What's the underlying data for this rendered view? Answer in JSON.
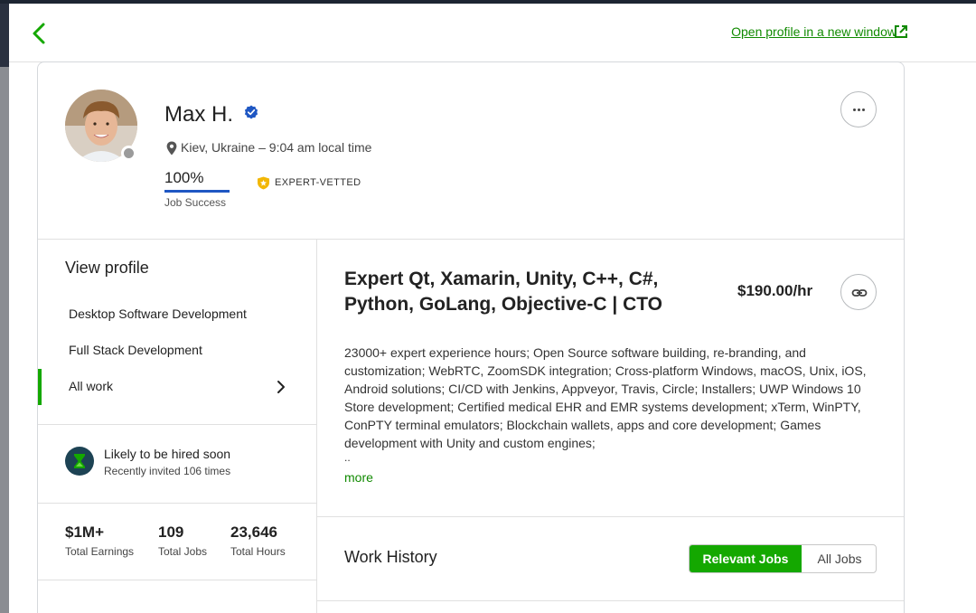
{
  "header": {
    "open_profile_link": "Open profile in a new window"
  },
  "profile": {
    "name": "Max H.",
    "location": "Kiev, Ukraine – 9:04 am local time",
    "job_success_value": "100%",
    "job_success_label": "Job Success",
    "job_success_fraction": 1.0,
    "badge": "EXPERT-VETTED"
  },
  "sidebar": {
    "heading": "View profile",
    "items": [
      {
        "label": "Desktop Software Development"
      },
      {
        "label": "Full Stack Development"
      },
      {
        "label": "All work"
      }
    ],
    "hired": {
      "title": "Likely to be hired soon",
      "subtitle": "Recently invited 106 times"
    },
    "stats": [
      {
        "value": "$1M+",
        "label": "Total Earnings"
      },
      {
        "value": "109",
        "label": "Total Jobs"
      },
      {
        "value": "23,646",
        "label": "Total Hours"
      }
    ]
  },
  "main": {
    "title": "Expert Qt, Xamarin, Unity, C++, C#, Python, GoLang, Objective-C | CTO",
    "rate": "$190.00/hr",
    "description": "23000+ expert experience hours; Open Source software building, re-branding, and customization; WebRTC, ZoomSDK integration; Cross-platform Windows, macOS, Unix, iOS, Android solutions; CI/CD with Jenkins, Appveyor, Travis, Circle; Installers; UWP Windows 10 Store development; Certified medical EHR and EMR systems development; xTerm, WinPTY, ConPTY terminal emulators; Blockchain wallets, apps and core development; Games development with Unity and custom engines;",
    "ellipsis": "..",
    "more_label": "more",
    "work_history": {
      "title": "Work History",
      "tabs": [
        "Relevant Jobs",
        "All Jobs"
      ]
    }
  },
  "colors": {
    "accent_green": "#14a800",
    "link_green": "#108a00",
    "job_success_bar": "#1f57c3",
    "verified_blue": "#1f57c3",
    "badge_gold": "#f2b705"
  }
}
